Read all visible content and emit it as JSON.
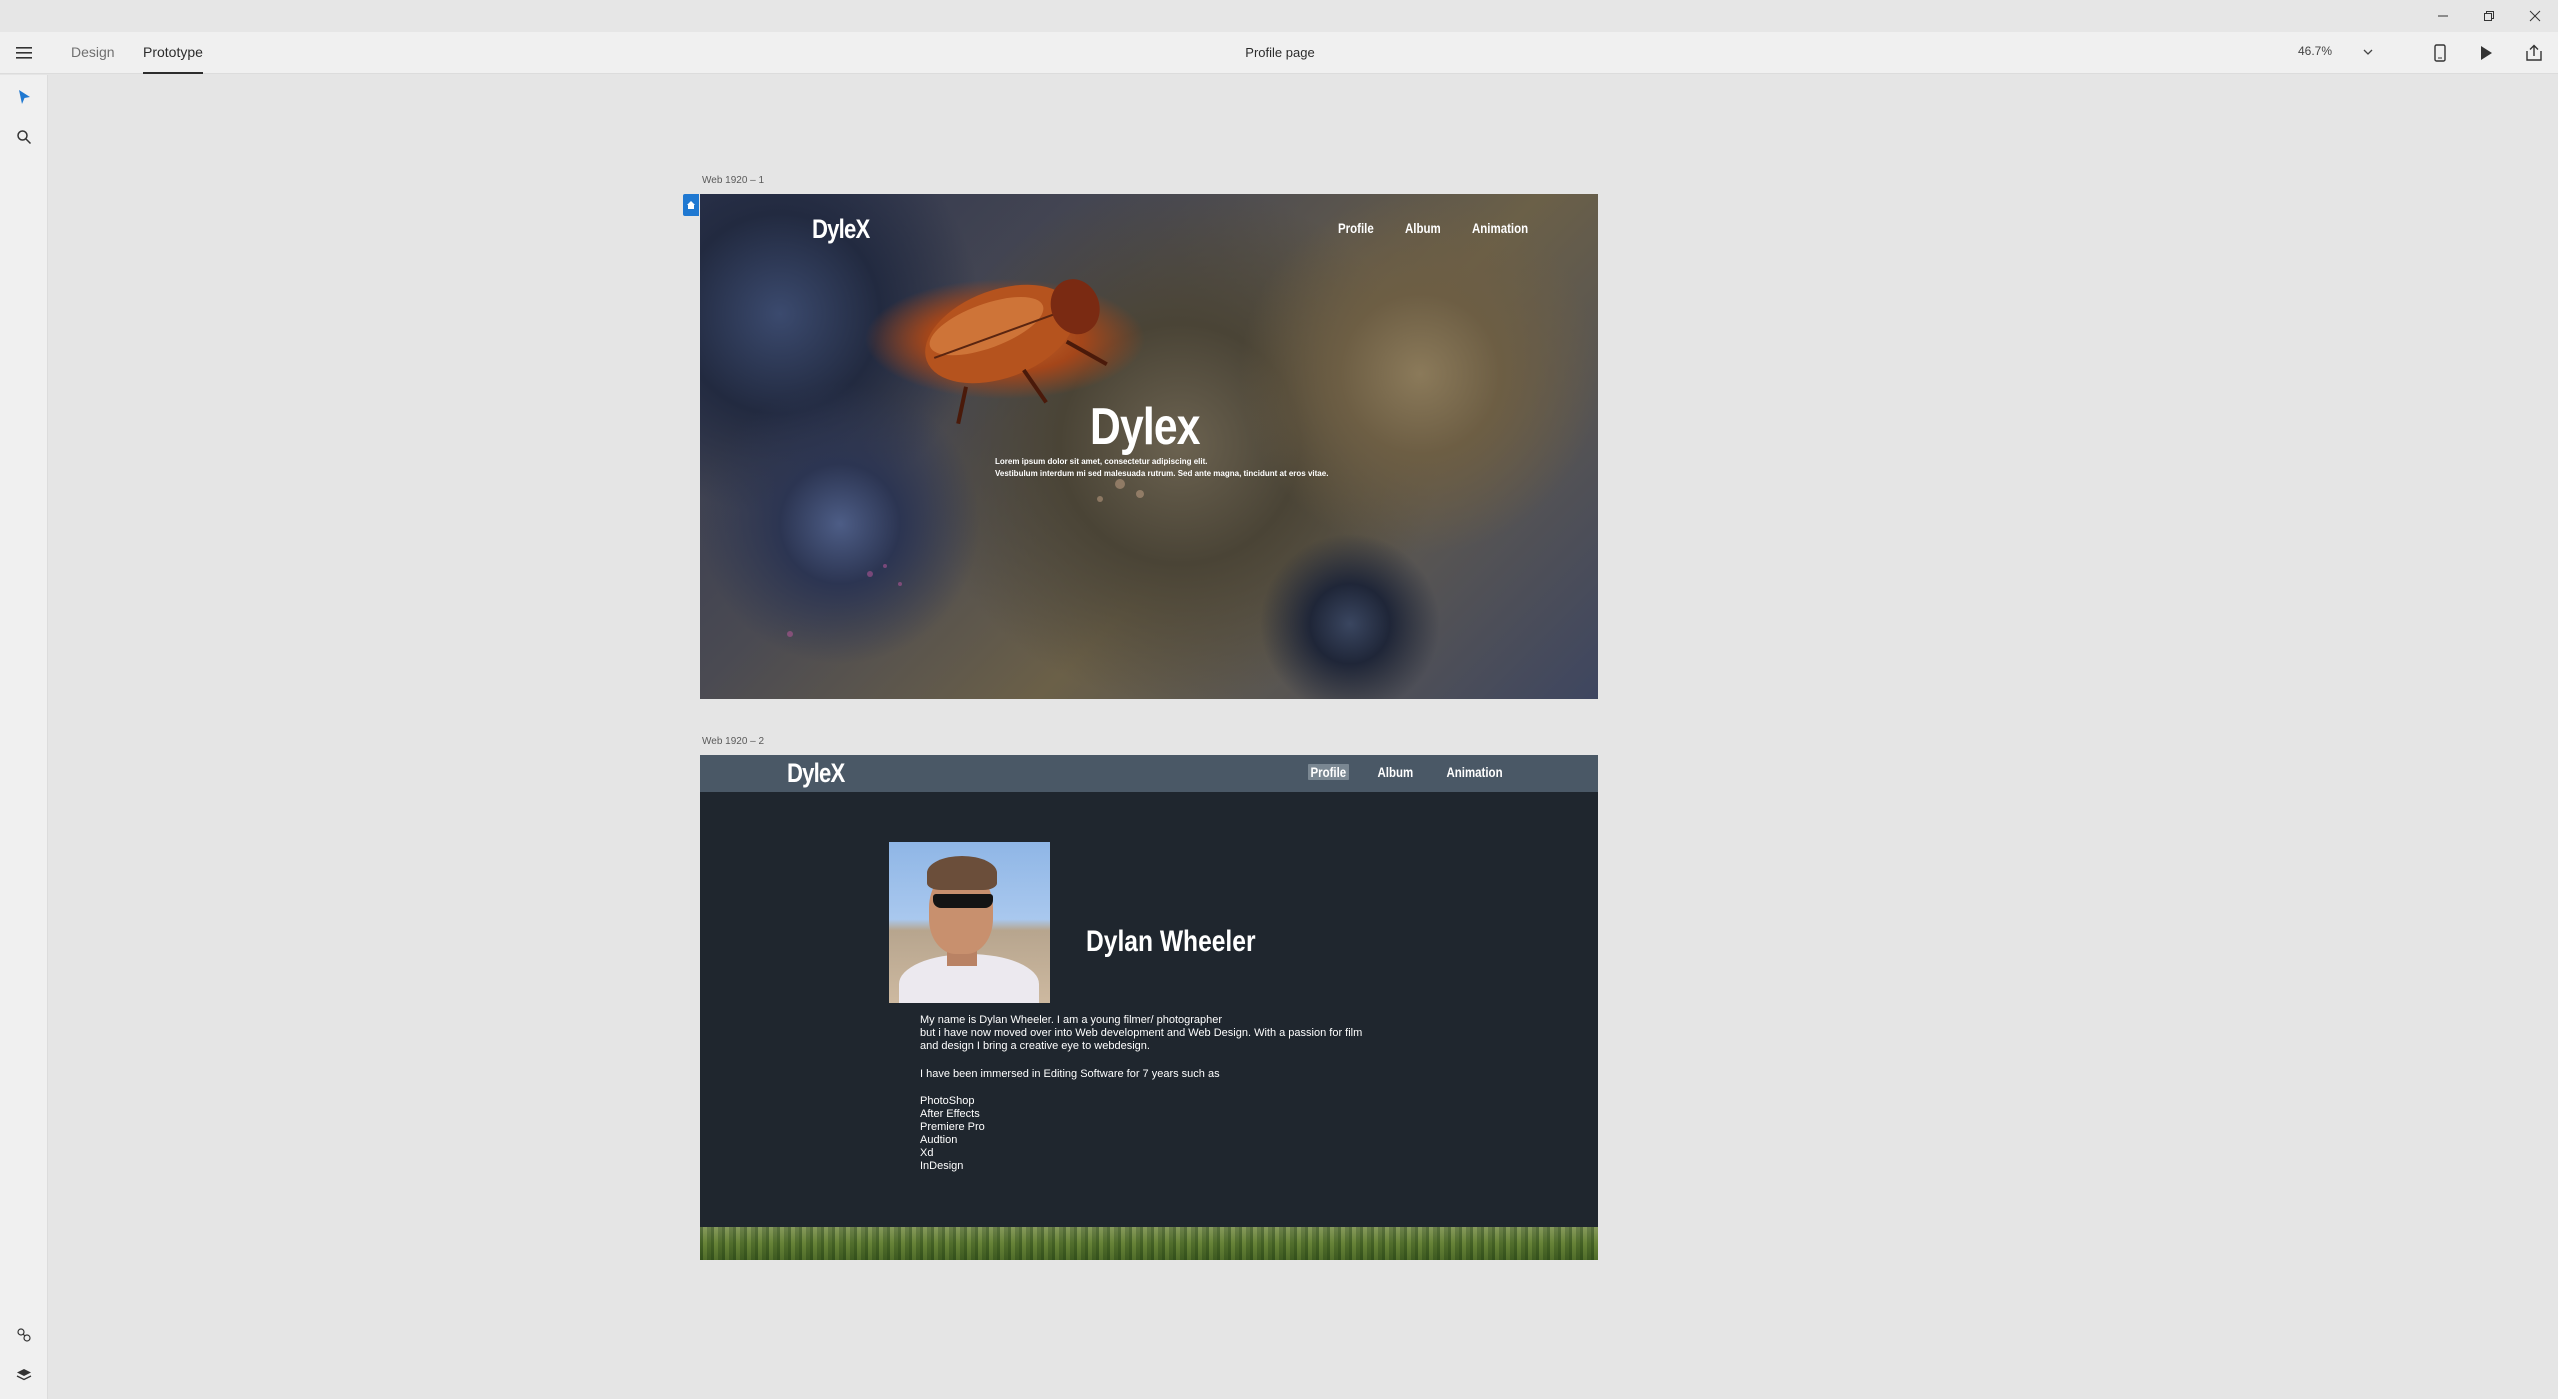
{
  "window": {
    "controls": [
      "minimize-icon",
      "restore-icon",
      "close-icon"
    ]
  },
  "toolbar": {
    "tabs": [
      {
        "label": "Design",
        "active": false
      },
      {
        "label": "Prototype",
        "active": true
      }
    ],
    "document_title": "Profile page",
    "zoom": "46.7%",
    "right_icons": [
      "mobile-preview-icon",
      "play-icon",
      "share-icon"
    ]
  },
  "leftbar": {
    "top_icons": [
      "select-arrow-icon",
      "search-icon"
    ],
    "bottom_icons": [
      "plugins-icon",
      "layers-icon"
    ]
  },
  "artboards": [
    {
      "label": "Web 1920 – 1",
      "logo": "DyleX",
      "nav": [
        "Profile",
        "Album",
        "Animation"
      ],
      "hero_title": "Dylex",
      "hero_lines": [
        "Lorem ipsum dolor sit amet, consectetur adipiscing elit.",
        "Vestibulum interdum mi sed malesuada rutrum. Sed ante magna, tincidunt at eros vitae."
      ]
    },
    {
      "label": "Web 1920 – 2",
      "logo": "DyleX",
      "nav": [
        "Profile",
        "Album",
        "Animation"
      ],
      "active_nav": "Profile",
      "name": "Dylan Wheeler",
      "bio": [
        "My name is Dylan Wheeler. I am a young filmer/ photographer",
        "but i have now moved over into Web development and Web Design. With a passion for film",
        "and design I bring a creative eye to webdesign.",
        "",
        "I have been immersed in Editing Software for 7 years such as",
        "",
        "PhotoShop",
        "After Effects",
        "Premiere Pro",
        "Audtion",
        "Xd",
        "InDesign"
      ]
    }
  ],
  "colors": {
    "accent": "#1f78d1",
    "artboard2_bg": "#1f262e",
    "artboard2_nav": "#4a5866"
  }
}
